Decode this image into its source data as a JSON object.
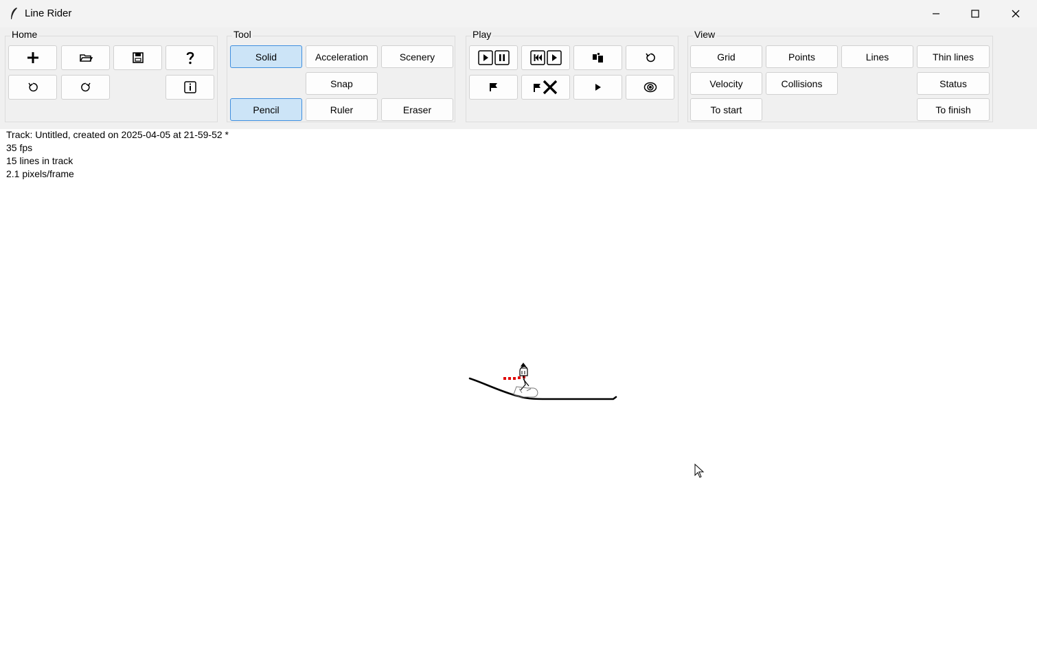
{
  "window": {
    "title": "Line Rider",
    "controls": [
      "minimize-icon",
      "maximize-icon",
      "close-icon"
    ]
  },
  "groups": {
    "home": {
      "label": "Home",
      "buttons": [
        "new-icon",
        "open-icon",
        "save-icon",
        "help-icon",
        "undo-icon",
        "redo-icon",
        "info-icon"
      ]
    },
    "tool": {
      "label": "Tool",
      "solid": "Solid",
      "acceleration": "Acceleration",
      "scenery": "Scenery",
      "snap": "Snap",
      "pencil": "Pencil",
      "ruler": "Ruler",
      "eraser": "Eraser",
      "selected": [
        "Solid",
        "Pencil"
      ]
    },
    "play": {
      "label": "Play",
      "buttons": [
        "play-pause-icon",
        "rewind-play-icon",
        "rider-icon",
        "reset-icon",
        "flag-icon",
        "remove-flag-icon",
        "play-icon",
        "view-icon"
      ]
    },
    "view": {
      "label": "View",
      "grid": "Grid",
      "points": "Points",
      "lines": "Lines",
      "thin_lines": "Thin lines",
      "velocity": "Velocity",
      "collisions": "Collisions",
      "status": "Status",
      "to_start": "To start",
      "to_finish": "To finish"
    }
  },
  "status": {
    "track": "Track: Untitled, created on 2025-04-05 at 21-59-52 *",
    "fps": "35 fps",
    "lines": "15 lines in track",
    "speed": "2.1 pixels/frame"
  },
  "colors": {
    "selected_bg": "#cce4f7",
    "selected_border": "#3e8ede",
    "toolbar_bg": "#f0f0f0",
    "velocity_marks": "#e00000"
  }
}
